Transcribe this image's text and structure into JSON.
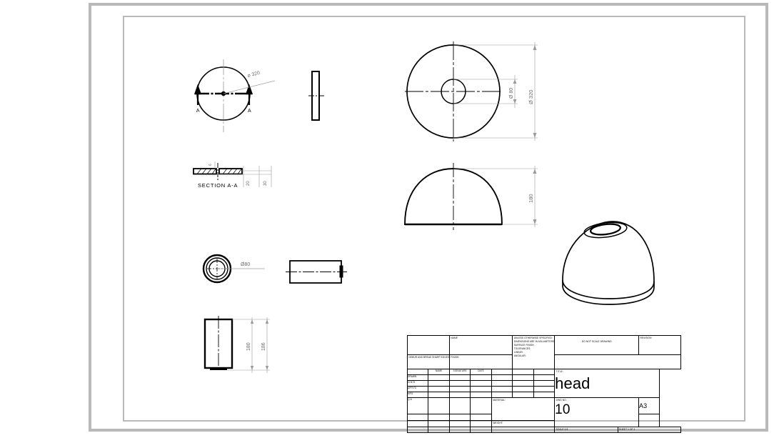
{
  "document": {
    "type": "engineering-drawing",
    "sheet_size": "A3",
    "title": "head",
    "drawing_number": "10",
    "scale": "SCALE:1:8",
    "sheet": "SHEET 1 OF 1",
    "weight_label": "WEIGHT:",
    "revision_label": "REVISION",
    "do_not_scale": "DO NOT SCALE DRAWING",
    "finish_label": "FINISH:",
    "material_label": "MATERIAL:",
    "debur_note": "DEBUR AND BREAK SHARP EDGES",
    "name_label": "NAME",
    "title_label": "TITLE:",
    "dwg_no_label": "DWG NO.",
    "unless_note_line1": "UNLESS OTHERWISE SPECIFIED:",
    "unless_note_line2": "DIMENSIONS ARE IN MILLIMETERS",
    "unless_note_line3": "SURFACE FINISH:",
    "unless_note_line4": "TOLERANCES:",
    "unless_note_line5": "   LINEAR:",
    "unless_note_line6": "   ANGULAR:",
    "columns": [
      "",
      "NAME",
      "SIGNATURE",
      "DATE",
      "",
      "",
      ""
    ],
    "rows": [
      "DRAWN",
      "CHK'D",
      "APPV'D",
      "MFG",
      "Q.A"
    ]
  },
  "views": {
    "top_section_circle": {
      "name": "sectioned-top-view",
      "diameter_label": "Ø 320",
      "section_letter_left": "A",
      "section_letter_right": "A"
    },
    "plate_edge": {
      "name": "plate-edge-view"
    },
    "section_aa": {
      "name": "section-a-a",
      "caption": "SECTION A-A",
      "dim_thickness": "6",
      "dim_inner": "20",
      "dim_outer": "30"
    },
    "main_top": {
      "name": "top-view",
      "outer_diameter": "Ø 320",
      "inner_diameter": "Ø 80"
    },
    "front_dome": {
      "name": "front-view",
      "height_dim": "180"
    },
    "boss_circle": {
      "name": "boss-circle-view",
      "diameter_label": "Ø80"
    },
    "boss_side": {
      "name": "boss-side-view"
    },
    "left_side": {
      "name": "left-side-view",
      "dim_inner": "180",
      "dim_outer": "186"
    },
    "isometric": {
      "name": "isometric-view"
    }
  },
  "colors": {
    "line": "#000000",
    "dimension": "#808080",
    "frame": "#b9b9b9",
    "paper": "#ffffff"
  }
}
